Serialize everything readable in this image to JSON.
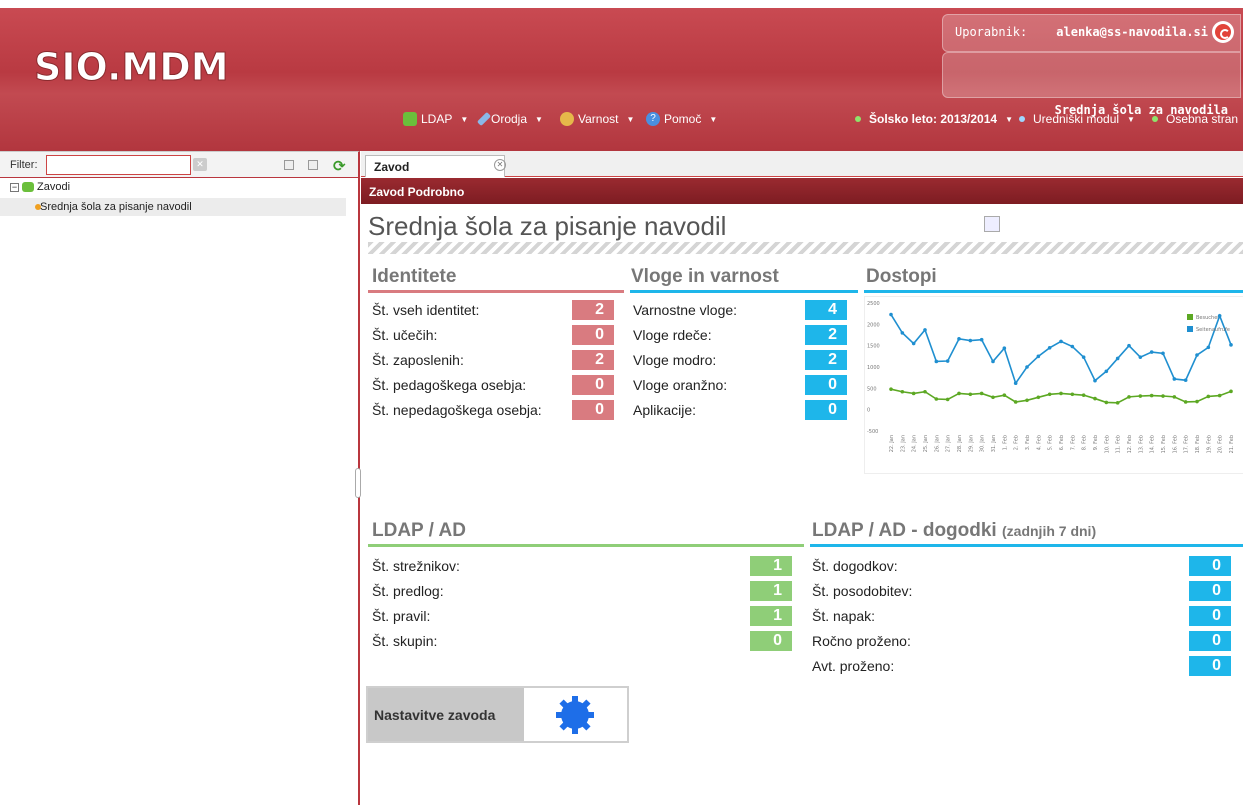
{
  "header": {
    "logo_text": "SIO.MDM",
    "user_label": "Uporabnik:",
    "user_email": "alenka@ss-navodila.si",
    "school_name": "Srednja šola za navodila",
    "menus": [
      {
        "label": "LDAP",
        "icon": "ldap-icon"
      },
      {
        "label": "Orodja",
        "icon": "tools-icon"
      },
      {
        "label": "Varnost",
        "icon": "security-icon"
      },
      {
        "label": "Pomoč",
        "icon": "help-icon"
      }
    ],
    "right_menus": [
      {
        "label": "Šolsko leto: 2013/2014"
      },
      {
        "label": "Uredniški modul"
      },
      {
        "label": "Osebna stran"
      }
    ]
  },
  "sidebar": {
    "filter_label": "Filter:",
    "filter_value": "",
    "tree_root": "Zavodi",
    "tree_child": "Srednja šola za pisanje navodil"
  },
  "tabs": [
    {
      "label": "Zavod"
    }
  ],
  "section_title": "Zavod Podrobno",
  "page_title": "Srednja šola za pisanje navodil",
  "identitete": {
    "heading": "Identitete",
    "color": "#d97b80",
    "rows": [
      {
        "label": "Št. vseh identitet:",
        "value": "2"
      },
      {
        "label": "Št. učečih:",
        "value": "0"
      },
      {
        "label": "Št. zaposlenih:",
        "value": "2"
      },
      {
        "label": "Št. pedagoškega osebja:",
        "value": "0"
      },
      {
        "label": "Št. nepedagoškega osebja:",
        "value": "0"
      }
    ]
  },
  "vloge": {
    "heading": "Vloge in varnost",
    "color": "#1eb6ea",
    "rows": [
      {
        "label": "Varnostne vloge:",
        "value": "4"
      },
      {
        "label": "Vloge rdeče:",
        "value": "2"
      },
      {
        "label": "Vloge modro:",
        "value": "2"
      },
      {
        "label": "Vloge oranžno:",
        "value": "0"
      },
      {
        "label": "Aplikacije:",
        "value": "0"
      }
    ]
  },
  "dostopi": {
    "heading": "Dostopi"
  },
  "ldap": {
    "heading": "LDAP / AD",
    "color": "#8fce78",
    "rows": [
      {
        "label": "Št. strežnikov:",
        "value": "1"
      },
      {
        "label": "Št. predlog:",
        "value": "1"
      },
      {
        "label": "Št. pravil:",
        "value": "1"
      },
      {
        "label": "Št. skupin:",
        "value": "0"
      }
    ]
  },
  "dogodki": {
    "heading": "LDAP / AD - dogodki",
    "subheading": "(zadnjih 7 dni)",
    "color": "#1eb6ea",
    "rows": [
      {
        "label": "Št. dogodkov:",
        "value": "0"
      },
      {
        "label": "Št. posodobitev:",
        "value": "0"
      },
      {
        "label": "Št. napak:",
        "value": "0"
      },
      {
        "label": "Ročno proženo:",
        "value": "0"
      },
      {
        "label": "Avt. proženo:",
        "value": "0"
      }
    ]
  },
  "settings": {
    "label": "Nastavitve zavoda"
  },
  "chart_data": {
    "type": "line",
    "x": [
      "22. Jan",
      "23. Jan",
      "24. Jan",
      "25. Jan",
      "26. Jan",
      "27. Jan",
      "28. Jan",
      "29. Jan",
      "30. Jan",
      "31. Jan",
      "1. Feb",
      "2. Feb",
      "3. Feb",
      "4. Feb",
      "5. Feb",
      "6. Feb",
      "7. Feb",
      "8. Feb",
      "9. Feb",
      "10. Feb",
      "11. Feb",
      "12. Feb",
      "13. Feb",
      "14. Feb",
      "15. Feb",
      "16. Feb",
      "17. Feb",
      "18. Feb",
      "19. Feb",
      "20. Feb",
      "21. Feb"
    ],
    "series": [
      {
        "name": "Besucher",
        "color": "#5ca823",
        "values": [
          480,
          420,
          380,
          420,
          250,
          240,
          380,
          360,
          380,
          290,
          340,
          180,
          220,
          290,
          360,
          380,
          360,
          340,
          260,
          170,
          160,
          300,
          320,
          330,
          320,
          300,
          180,
          190,
          310,
          330,
          430
        ]
      },
      {
        "name": "Seitenaufrufe",
        "color": "#1f8fd0",
        "values": [
          2230,
          1800,
          1550,
          1870,
          1130,
          1140,
          1660,
          1620,
          1640,
          1130,
          1440,
          620,
          1000,
          1250,
          1450,
          1600,
          1480,
          1230,
          680,
          900,
          1200,
          1500,
          1230,
          1350,
          1320,
          720,
          690,
          1280,
          1460,
          2200,
          1520
        ]
      }
    ],
    "ylim": [
      -500,
      2500
    ],
    "yticks": [
      -500,
      0,
      500,
      1000,
      1500,
      2000,
      2500
    ],
    "legend": "top-right",
    "grid": false
  }
}
